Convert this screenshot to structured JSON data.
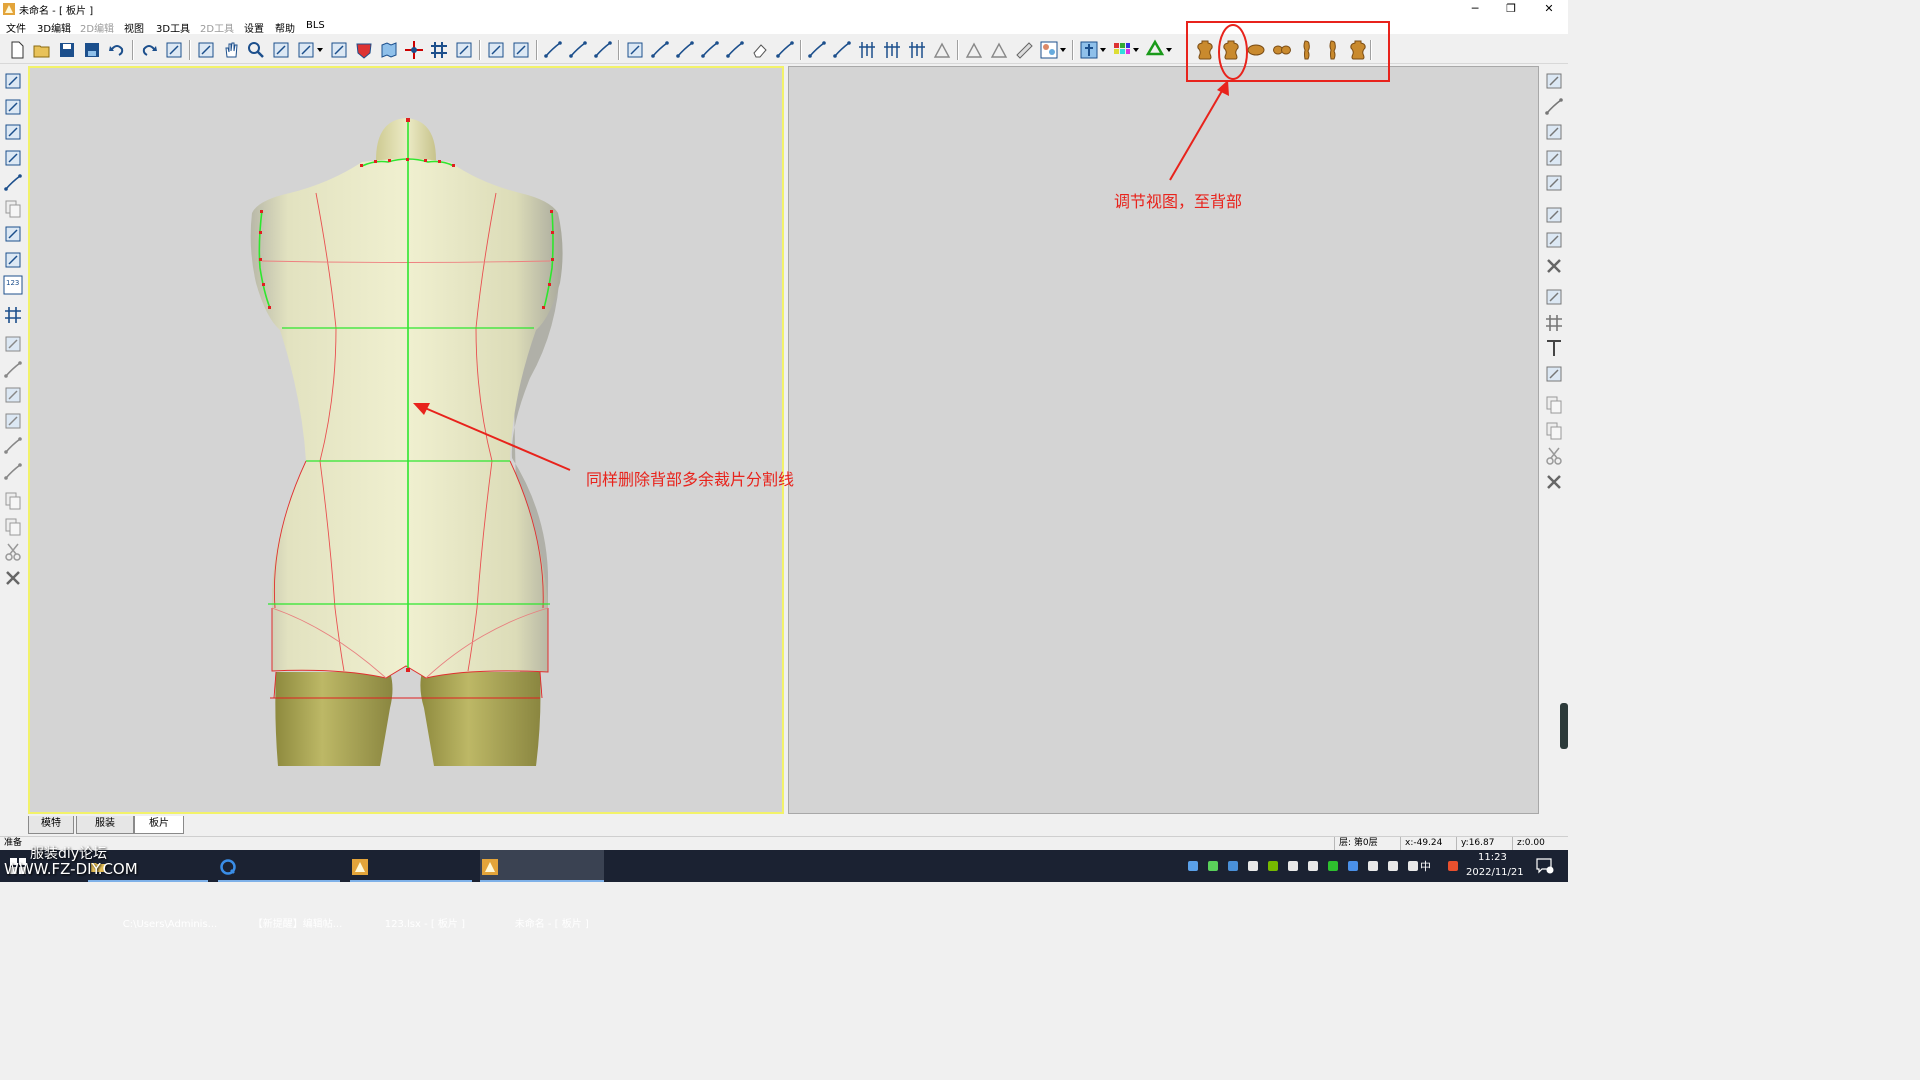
{
  "window": {
    "title": "未命名 - [ 板片 ]",
    "minimize_glyph": "─",
    "restore_glyph": "❐",
    "close_glyph": "✕"
  },
  "menu": [
    {
      "label": "文件",
      "enabled": true
    },
    {
      "label": "3D编辑",
      "enabled": true
    },
    {
      "label": "2D编辑",
      "enabled": false
    },
    {
      "label": "视图",
      "enabled": true
    },
    {
      "label": "3D工具",
      "enabled": true
    },
    {
      "label": "2D工具",
      "enabled": false
    },
    {
      "label": "设置",
      "enabled": true
    },
    {
      "label": "帮助",
      "enabled": true
    },
    {
      "label": "BLS",
      "enabled": true
    }
  ],
  "toolbar_icons": [
    "new-file-icon",
    "open-folder-icon",
    "save-icon",
    "save-all-icon",
    "undo-icon",
    "redo-icon",
    "panel-icon",
    "rotate-view-icon",
    "pan-hand-icon",
    "zoom-icon",
    "orbit-icon",
    "cube-view-icon",
    "shape-icon",
    "shield-icon",
    "map-icon",
    "move-axes-icon",
    "grid-icon",
    "import-icon",
    "save-to-icon",
    "save-as-icon",
    "line-tool-icon",
    "polyline-icon",
    "pen-icon",
    "point-icon",
    "curve-icon",
    "arc-icon",
    "multi-curve-icon",
    "multi-arc-icon",
    "eraser-icon",
    "diagonal-line-icon",
    "diagonal-line-2-icon",
    "double-line-icon",
    "align-vertical-icon",
    "align-vertical-2-icon",
    "align-center-icon",
    "angle-icon",
    "triangle-icon",
    "triangle-2-icon",
    "ruler-icon",
    "texture-icon",
    "fit-model-icon",
    "color-grid-icon",
    "recycle-icon"
  ],
  "view_presets": [
    {
      "icon": "front-view-icon"
    },
    {
      "icon": "back-view-icon"
    },
    {
      "icon": "top-view-icon"
    },
    {
      "icon": "bottom-view-icon"
    },
    {
      "icon": "left-view-icon"
    },
    {
      "icon": "right-view-icon"
    },
    {
      "icon": "perspective-view-icon"
    }
  ],
  "left_tools": [
    "select-panel-icon",
    "brush-icon",
    "paint-icon",
    "texture-tool-icon",
    "line-draw-icon",
    "copy-panel-icon",
    "mirror-icon",
    "duplicate-icon",
    "numbering-icon",
    "grid-tool-icon",
    "symmetry-icon",
    "curve-edit-icon",
    "point-edit-icon",
    "ruler-vertical-icon",
    "arc-tool-icon",
    "line-measure-icon",
    "copy-icon",
    "paste-icon",
    "cut-icon",
    "delete-icon"
  ],
  "right_tools": [
    "pointer-icon",
    "pencil-icon",
    "scale-icon",
    "rotate-icon",
    "measure-icon",
    "offset-icon",
    "offset-2-icon",
    "x-icon",
    "texture-2-icon",
    "grid-2-icon",
    "text-icon",
    "image-icon",
    "copy-2-icon",
    "paste-2-icon",
    "cut-2-icon",
    "delete-2-icon"
  ],
  "tabs": [
    {
      "label": "模特",
      "active": false
    },
    {
      "label": "服装",
      "active": false
    },
    {
      "label": "板片",
      "active": true
    }
  ],
  "status": {
    "ready": "准备",
    "layer": "层: 第0层",
    "x": "x:-49.24",
    "y": "y:16.87",
    "z": "z:0.00"
  },
  "annotations": {
    "view_note": "调节视图，至背部",
    "delete_note": "同样删除背部多余裁片分割线"
  },
  "taskbar": {
    "tasks": [
      {
        "label": "C:\\Users\\Adminis...",
        "icon": "folder-icon"
      },
      {
        "label": "【新提醒】编辑帖...",
        "icon": "browser-icon"
      },
      {
        "label": "123.lsx - [ 板片 ]",
        "icon": "app-icon"
      },
      {
        "label": "未命名 - [ 板片 ]",
        "icon": "app-icon"
      }
    ],
    "tray": [
      "cloud-icon",
      "wechat-icon",
      "shield-tray-icon",
      "plugin-icon",
      "nvidia-icon",
      "media-icon",
      "speaker-mute-icon",
      "green-icon",
      "bluetooth-icon",
      "network-icon",
      "wifi-icon",
      "volume-icon",
      "ime-icon",
      "sogou-icon"
    ],
    "ime_label": "中",
    "time": "11:23",
    "date": "2022/11/21"
  },
  "watermark": {
    "line1": "服装diy论坛",
    "line2": "WWW.FZ-DIY.COM"
  },
  "colors": {
    "annotation_red": "#e8231c",
    "seam_green": "#2ee62e",
    "viewport_border": "#f2f26a",
    "mannequin_light": "#ececc8",
    "mannequin_leg": "#b8b45c"
  }
}
